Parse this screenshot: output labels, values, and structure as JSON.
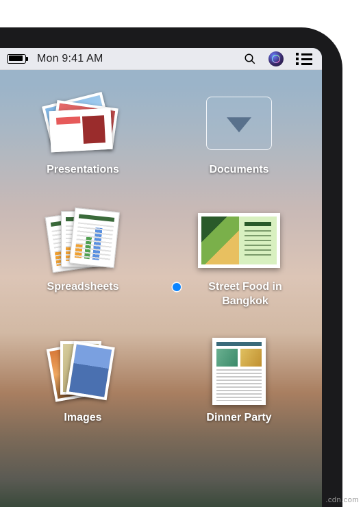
{
  "menubar": {
    "clock": "Mon 9:41 AM"
  },
  "stacks": [
    {
      "label": "Presentations",
      "tagged": false
    },
    {
      "label": "Documents",
      "tagged": false
    },
    {
      "label": "Spreadsheets",
      "tagged": false
    },
    {
      "label": "Street Food in Bangkok",
      "tagged": true,
      "tag_color": "#0a84ff"
    },
    {
      "label": "Images",
      "tagged": false
    },
    {
      "label": "Dinner Party",
      "tagged": false
    }
  ],
  "watermark": ".cdn.com"
}
